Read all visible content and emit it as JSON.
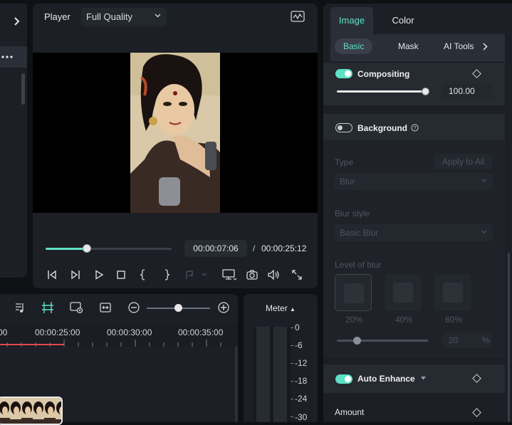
{
  "player": {
    "title": "Player",
    "quality": "Full Quality",
    "time_current": "00:00:07:06",
    "time_separator": "/",
    "time_total": "00:00:25:12",
    "progress": 0.33
  },
  "timeline": {
    "ruler_labels": [
      "00",
      "00:00:25:00",
      "00:00:30:00",
      "00:00:35:00"
    ],
    "zoom_level": 0.5
  },
  "meter": {
    "title": "Meter",
    "scale": [
      "0",
      "-6",
      "-12",
      "-18",
      "-24",
      "-30"
    ]
  },
  "inspector": {
    "tabs": [
      "Image",
      "Color"
    ],
    "subtabs": [
      "Basic",
      "Mask",
      "AI Tools"
    ],
    "compositing": {
      "label": "Compositing",
      "enabled": true,
      "opacity_value": "100.00",
      "opacity": 1.0
    },
    "background": {
      "label": "Background",
      "enabled": false,
      "type_label": "Type",
      "apply_all": "Apply to All",
      "type_value": "Blur",
      "style_label": "Blur style",
      "style_value": "Basic Blur",
      "level_label": "Level of blur",
      "presets": [
        "20%",
        "40%",
        "60%"
      ],
      "level_value": "20",
      "level_unit": "%",
      "level": 0.2
    },
    "auto_enhance": {
      "label": "Auto Enhance",
      "enabled": true,
      "amount_label": "Amount"
    }
  },
  "colors": {
    "accent": "#5de2c6",
    "playhead": "#e3484d",
    "panel": "#1c1f25"
  }
}
